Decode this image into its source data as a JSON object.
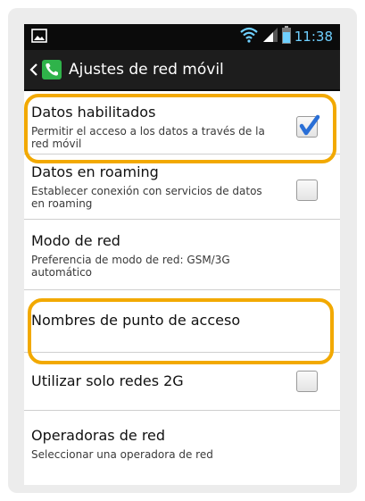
{
  "status_bar": {
    "time": "11:38",
    "icons": [
      "image-icon",
      "wifi-icon",
      "signal-icon",
      "battery-icon"
    ]
  },
  "action_bar": {
    "title": "Ajustes de red móvil",
    "icons": [
      "back-chevron-icon",
      "phone-app-icon"
    ]
  },
  "settings": [
    {
      "title": "Datos habilitados",
      "subtitle": "Permitir el acceso a los datos a través de la red móvil",
      "has_checkbox": true,
      "checked": true
    },
    {
      "title": "Datos en roaming",
      "subtitle": "Establecer conexión con servicios de datos en roaming",
      "has_checkbox": true,
      "checked": false
    },
    {
      "title": "Modo de red",
      "subtitle": "Preferencia de modo de red: GSM/3G automático",
      "has_checkbox": false
    },
    {
      "title": "Nombres de punto de acceso",
      "subtitle": "",
      "has_checkbox": false
    },
    {
      "title": "Utilizar solo redes 2G",
      "subtitle": "",
      "has_checkbox": true,
      "checked": false
    },
    {
      "title": "Operadoras de red",
      "subtitle": "Seleccionar una operadora de red",
      "has_checkbox": false
    }
  ],
  "colors": {
    "highlight": "#f2a900",
    "check": "#2a6fd6",
    "status_time": "#6fd0ff",
    "phone_app": "#2fb34a"
  }
}
